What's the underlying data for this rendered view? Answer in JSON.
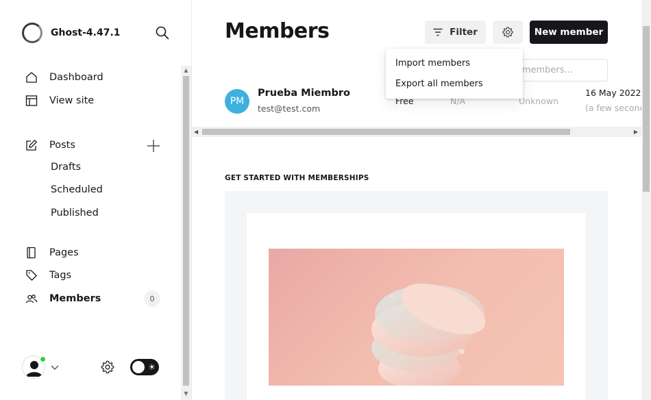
{
  "sidebar": {
    "site_name": "Ghost-4.47.1",
    "nav": [
      {
        "label": "Dashboard",
        "icon": "home-icon"
      },
      {
        "label": "View site",
        "icon": "browser-icon"
      },
      {
        "label": "Posts",
        "icon": "edit-icon"
      },
      {
        "label": "Pages",
        "icon": "page-icon"
      },
      {
        "label": "Tags",
        "icon": "tag-icon"
      },
      {
        "label": "Members",
        "icon": "members-icon"
      }
    ],
    "posts_sub": [
      "Drafts",
      "Scheduled",
      "Published"
    ],
    "members_count": "0"
  },
  "header": {
    "title": "Members",
    "filter_label": "Filter",
    "new_member_label": "New member"
  },
  "search": {
    "placeholder": "Search members..."
  },
  "dropdown": {
    "options": [
      "Import members",
      "Export all members"
    ]
  },
  "members": [
    {
      "initials": "PM",
      "name": "Prueba Miembro",
      "email": "test@test.com",
      "status": "Free",
      "open_rate": "N/A",
      "location": "Unknown",
      "created_date": "16 May 2022",
      "created_ago": "(a few seconds ago)"
    }
  ],
  "onboarding": {
    "section_title": "GET STARTED WITH MEMBERSHIPS"
  },
  "colors": {
    "accent": "#15171a",
    "avatar": "#3db0e0",
    "online": "#30cf43"
  }
}
